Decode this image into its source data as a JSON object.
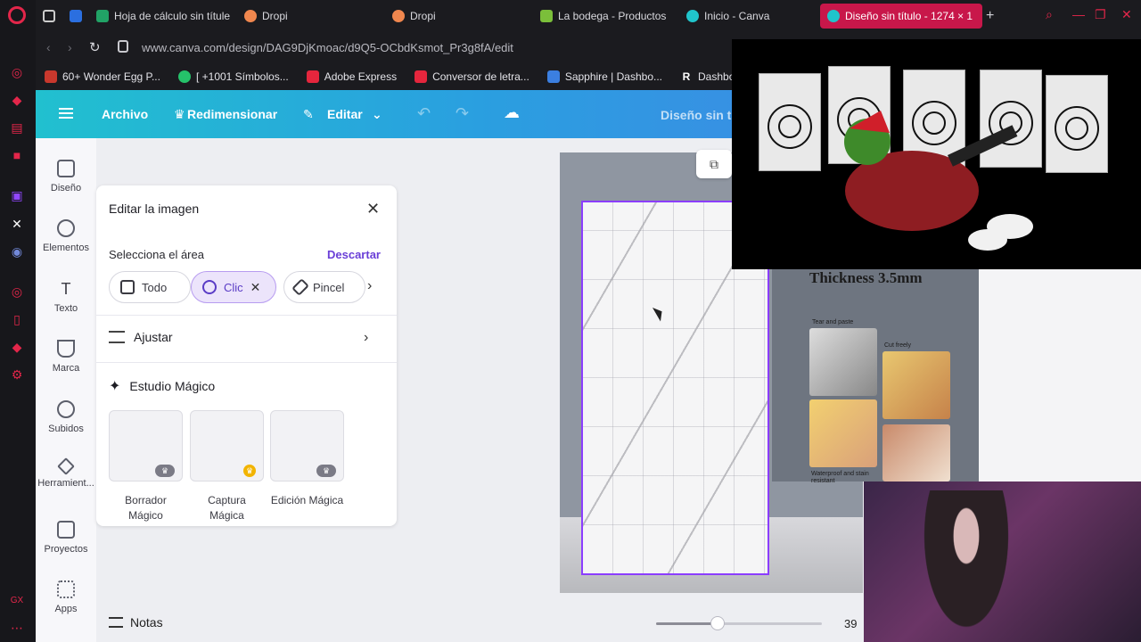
{
  "browser": {
    "tabs": [
      {
        "label": "Hoja de cálculo sin títule",
        "color": "#21a366"
      },
      {
        "label": "Dropi",
        "color": "#f0874e"
      },
      {
        "label": "Dropi",
        "color": "#f0874e"
      },
      {
        "label": "La bodega - Productos",
        "color": "#7bbf3a"
      },
      {
        "label": "Inicio - Canva",
        "color": "#20c4cb"
      },
      {
        "label": "Diseño sin título - 1274 × 1",
        "color": "#20c4cb",
        "active": true
      }
    ],
    "new_tab_glyph": "+",
    "url": "www.canva.com/design/DAG9DjKmoac/d9Q5-OCbdKsmot_Pr3g8fA/edit",
    "bookmarks": [
      {
        "label": "60+ Wonder Egg P...",
        "color": "#c9382d"
      },
      {
        "label": "[ +1001 Símbolos...",
        "color": "#25c26a"
      },
      {
        "label": "Adobe Express",
        "color": "#e5263d"
      },
      {
        "label": "Conversor de letra...",
        "color": "#e5263d"
      },
      {
        "label": "Sapphire | Dashbo...",
        "color": "#3b7fe0"
      },
      {
        "label": "Dashboard",
        "color": "#1b1b1f"
      }
    ]
  },
  "canva": {
    "menu": {
      "archivo": "Archivo",
      "redimensionar": "Redimensionar",
      "editar": "Editar",
      "design_title": "Diseño sin tí"
    },
    "sidebar": [
      {
        "label": "Diseño",
        "icon": "layout-icon"
      },
      {
        "label": "Elementos",
        "icon": "shapes-icon"
      },
      {
        "label": "Texto",
        "icon": "text-icon"
      },
      {
        "label": "Marca",
        "icon": "brand-icon"
      },
      {
        "label": "Subidos",
        "icon": "cloud-upload-icon"
      },
      {
        "label": "Herramient...",
        "icon": "tools-icon"
      },
      {
        "label": "Proyectos",
        "icon": "folder-icon"
      },
      {
        "label": "Apps",
        "icon": "apps-icon"
      }
    ],
    "panel": {
      "title": "Editar la imagen",
      "select_area": "Selecciona el área",
      "discard": "Descartar",
      "chips": [
        {
          "label": "Todo",
          "active": false
        },
        {
          "label": "Clic",
          "active": true
        },
        {
          "label": "Pincel",
          "active": false
        }
      ],
      "adjust": "Ajustar",
      "magic_studio": "Estudio Mágico",
      "magic_tools": [
        {
          "label": "Borrador Mágico",
          "badge": "crown"
        },
        {
          "label": "Captura Mágica",
          "badge": "gold-crown"
        },
        {
          "label": "Edición Mágica",
          "badge": "crown"
        }
      ]
    },
    "product": {
      "thickness": "Thickness 3.5mm",
      "caption1": "Tear and paste",
      "caption2": "Cut freely",
      "caption3": "Waterproof and stain resistant"
    },
    "notes": "Notas",
    "zoom_value": "39",
    "zoom_fraction": 0.37
  },
  "colors": {
    "accent_purple": "#8b3dff",
    "opera_red": "#e3264a",
    "active_tab": "#c8174a"
  }
}
